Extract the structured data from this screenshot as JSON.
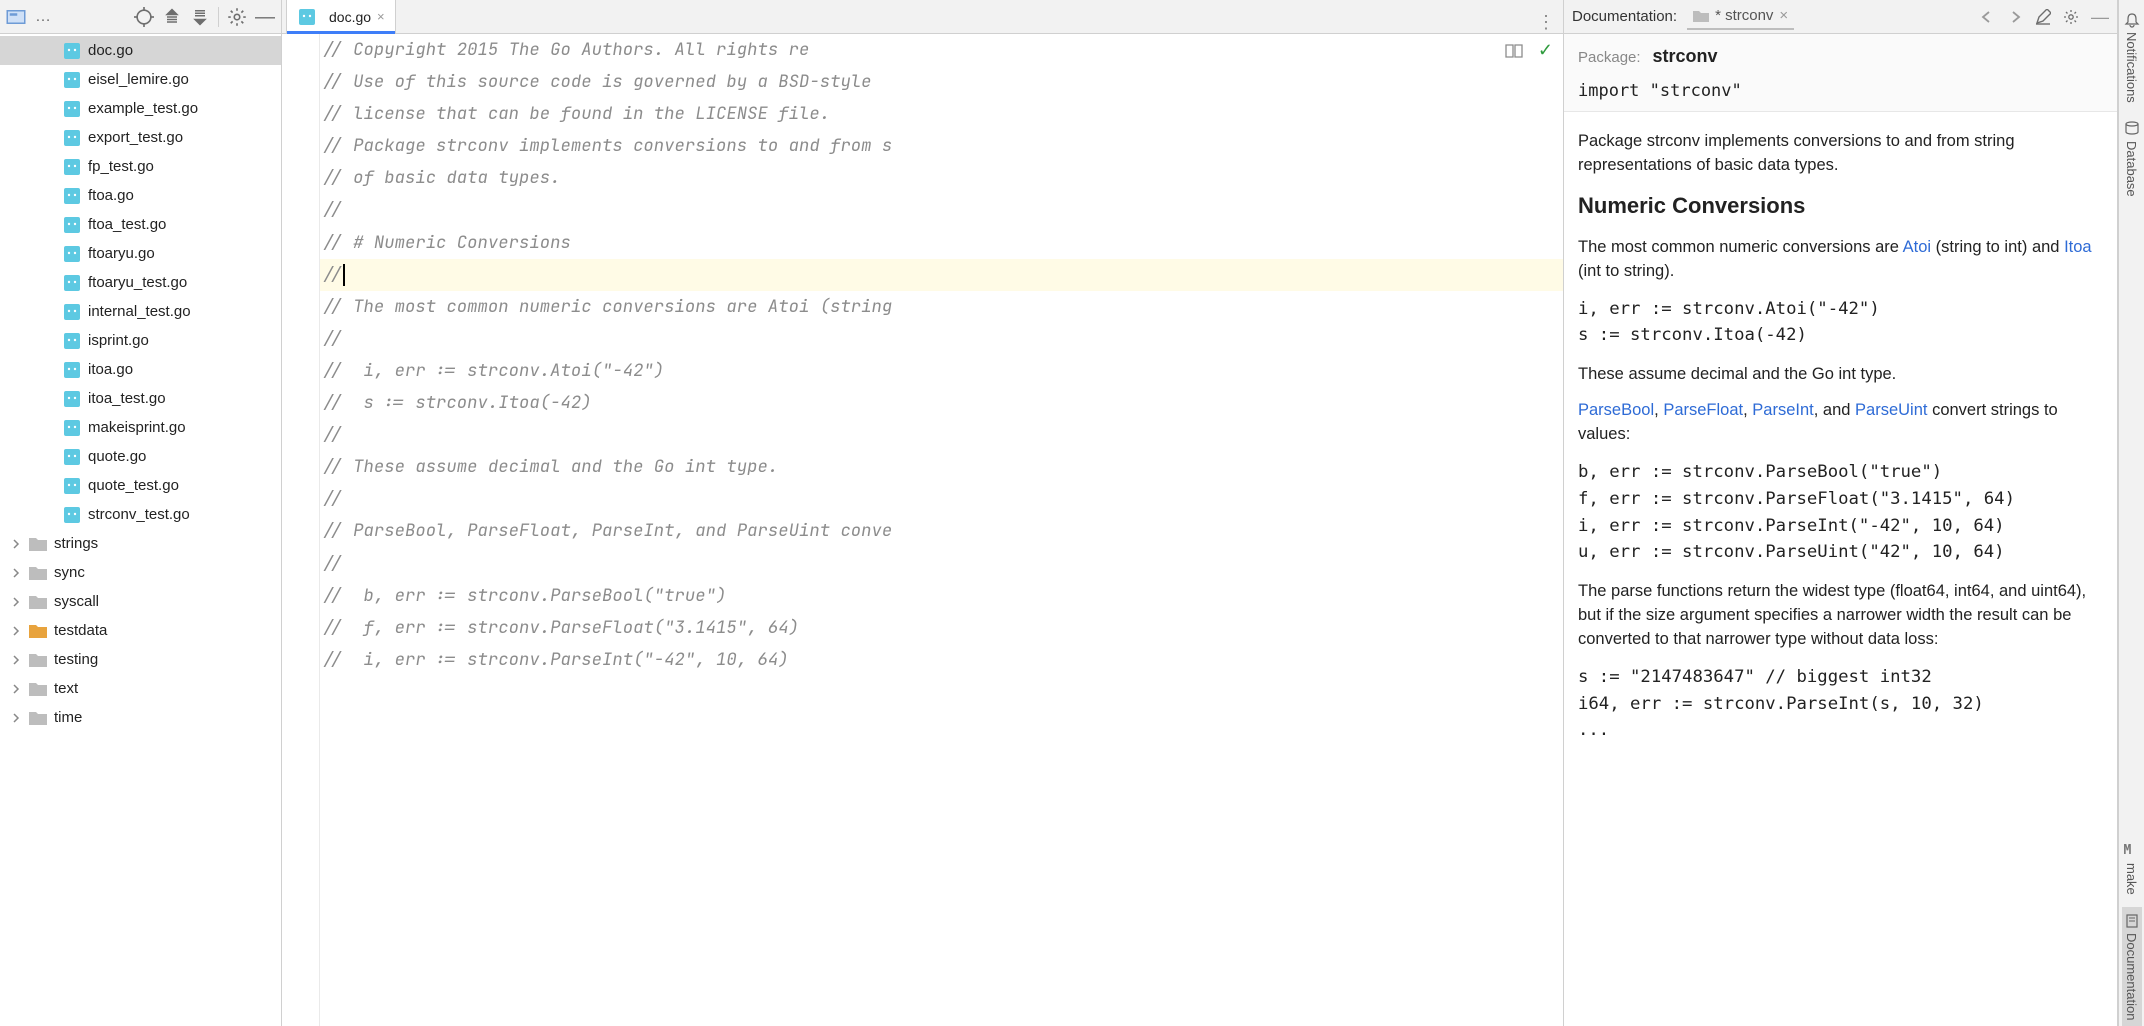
{
  "project": {
    "files": [
      "doc.go",
      "eisel_lemire.go",
      "example_test.go",
      "export_test.go",
      "fp_test.go",
      "ftoa.go",
      "ftoa_test.go",
      "ftoaryu.go",
      "ftoaryu_test.go",
      "internal_test.go",
      "isprint.go",
      "itoa.go",
      "itoa_test.go",
      "makeisprint.go",
      "quote.go",
      "quote_test.go",
      "strconv_test.go"
    ],
    "selected_file": "doc.go",
    "folders": [
      "strings",
      "sync",
      "syscall",
      "testdata",
      "testing",
      "text",
      "time"
    ],
    "highlight_folder": "testdata"
  },
  "editor": {
    "tab_label": "doc.go",
    "lines": [
      "// Copyright 2015 The Go Authors. All rights re",
      "// Use of this source code is governed by a BSD-style",
      "// license that can be found in the LICENSE file.",
      "",
      "// Package strconv implements conversions to and from s",
      "// of basic data types.",
      "//",
      "// # Numeric Conversions",
      "//",
      "// The most common numeric conversions are Atoi (string",
      "//",
      "//  i, err := strconv.Atoi(\"-42\")",
      "//  s := strconv.Itoa(-42)",
      "//",
      "// These assume decimal and the Go int type.",
      "//",
      "// ParseBool, ParseFloat, ParseInt, and ParseUint conve",
      "//",
      "//  b, err := strconv.ParseBool(\"true\")",
      "//  f, err := strconv.ParseFloat(\"3.1415\", 64)",
      "//  i, err := strconv.ParseInt(\"-42\", 10, 64)"
    ],
    "current_line_index": 8
  },
  "doc": {
    "toolbar_title": "Documentation:",
    "tab_label": "* strconv",
    "pkg_label": "Package:",
    "pkg_name": "strconv",
    "import_line": "import \"strconv\"",
    "summary": "Package strconv implements conversions to and from string representations of basic data types.",
    "h2": "Numeric Conversions",
    "p1_pre": "The most common numeric conversions are ",
    "link_atoi": "Atoi",
    "p1_mid": " (string to int) and ",
    "link_itoa": "Itoa",
    "p1_post": " (int to string).",
    "code1": "i, err := strconv.Atoi(\"-42\")\ns := strconv.Itoa(-42)",
    "p2": "These assume decimal and the Go int type.",
    "link_parsebool": "ParseBool",
    "link_parsefloat": "ParseFloat",
    "link_parseint": "ParseInt",
    "link_parseuint": "ParseUint",
    "p3_mid1": ", ",
    "p3_mid2": ", ",
    "p3_mid3": ", and ",
    "p3_post": " convert strings to values:",
    "code2": "b, err := strconv.ParseBool(\"true\")\nf, err := strconv.ParseFloat(\"3.1415\", 64)\ni, err := strconv.ParseInt(\"-42\", 10, 64)\nu, err := strconv.ParseUint(\"42\", 10, 64)",
    "p4": "The parse functions return the widest type (float64, int64, and uint64), but if the size argument specifies a narrower width the result can be converted to that narrower type without data loss:",
    "code3": "s := \"2147483647\" // biggest int32\ni64, err := strconv.ParseInt(s, 10, 32)\n..."
  },
  "right_strip": {
    "notifications": "Notifications",
    "database": "Database",
    "make": "make",
    "documentation": "Documentation"
  }
}
